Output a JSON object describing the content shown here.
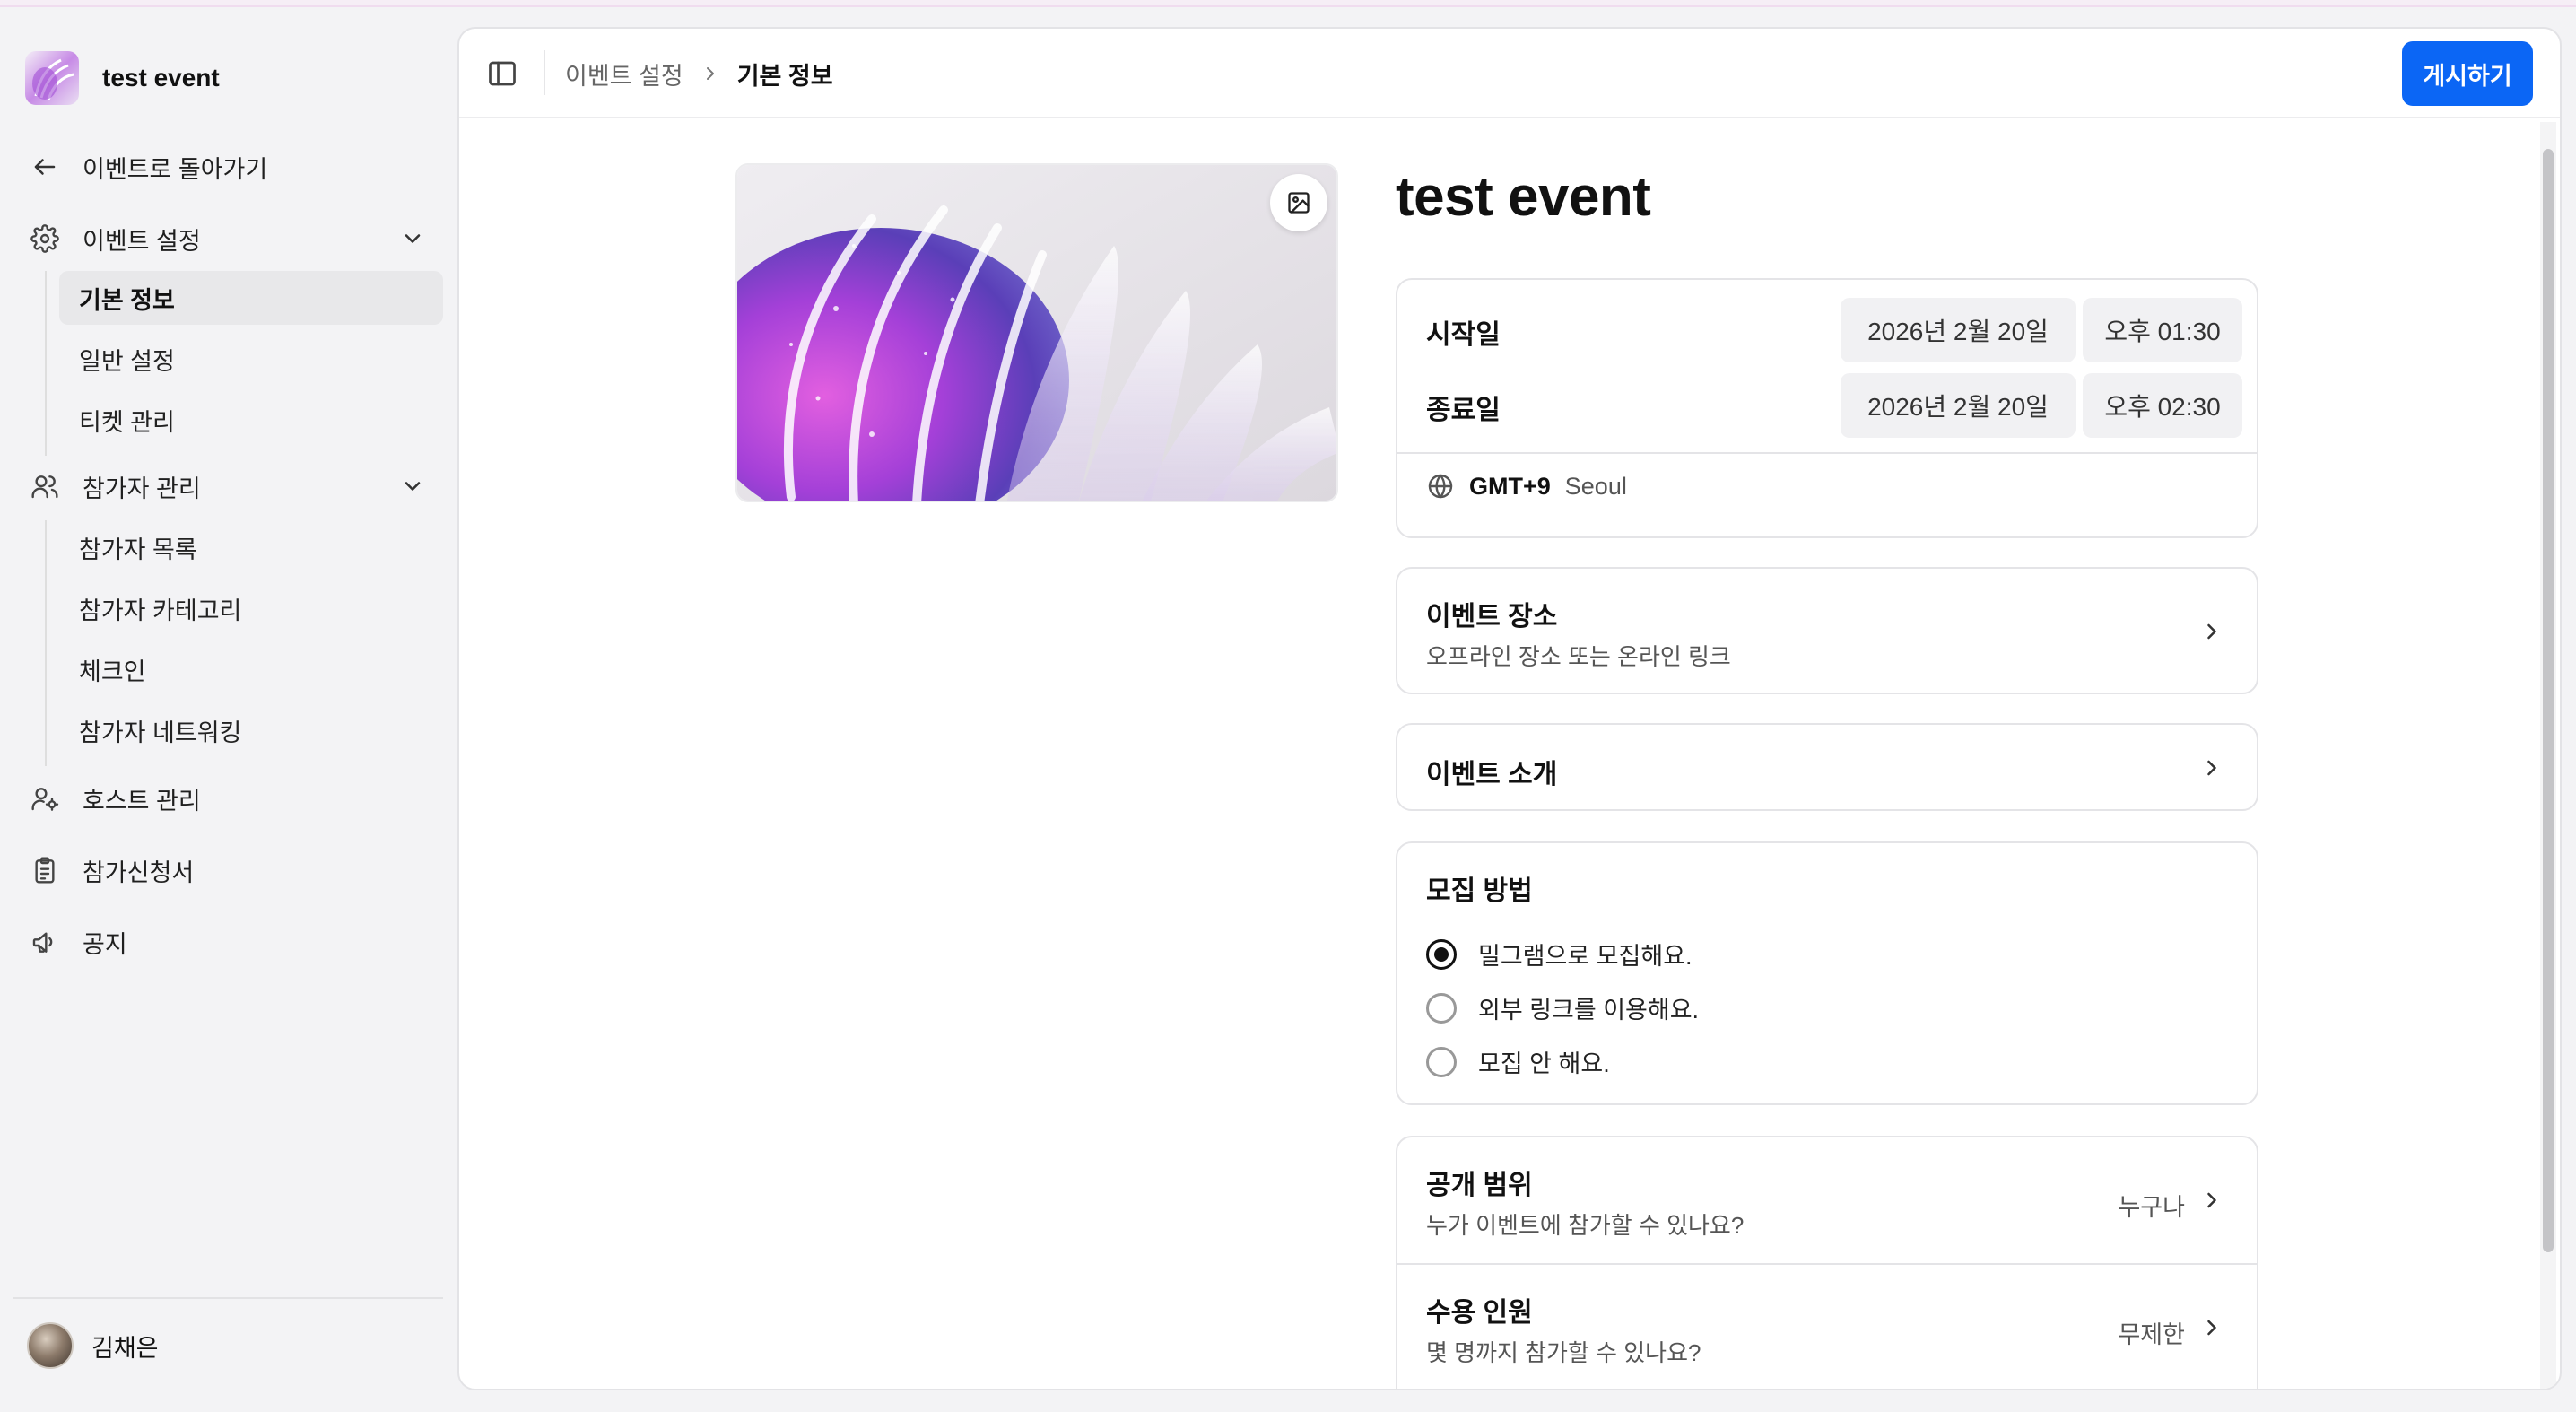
{
  "sidebar": {
    "event_name": "test event",
    "back_label": "이벤트로 돌아가기",
    "groups": [
      {
        "label": "이벤트 설정",
        "items": [
          "기본 정보",
          "일반 설정",
          "티켓 관리"
        ]
      },
      {
        "label": "참가자 관리",
        "items": [
          "참가자 목록",
          "참가자 카테고리",
          "체크인",
          "참가자 네트워킹"
        ]
      }
    ],
    "host_label": "호스트 관리",
    "application_label": "참가신청서",
    "notice_label": "공지",
    "user_name": "김채은"
  },
  "header": {
    "breadcrumb_parent": "이벤트 설정",
    "breadcrumb_current": "기본 정보",
    "publish_label": "게시하기"
  },
  "event": {
    "title": "test event",
    "start_label": "시작일",
    "start_date": "2026년 2월 20일",
    "start_time": "오후 01:30",
    "end_label": "종료일",
    "end_date": "2026년 2월 20일",
    "end_time": "오후 02:30",
    "tz_offset": "GMT+9",
    "tz_city": "Seoul"
  },
  "location": {
    "title": "이벤트 장소",
    "subtitle": "오프라인 장소 또는 온라인 링크"
  },
  "intro": {
    "title": "이벤트 소개"
  },
  "recruit": {
    "title": "모집 방법",
    "options": [
      "밀그램으로 모집해요.",
      "외부 링크를 이용해요.",
      "모집 안 해요."
    ],
    "selected_index": 0
  },
  "visibility": {
    "title": "공개 범위",
    "subtitle": "누가 이벤트에 참가할 수 있나요?",
    "value": "누구나"
  },
  "capacity": {
    "title": "수용 인원",
    "subtitle": "몇 명까지 참가할 수 있나요?",
    "value": "무제한"
  },
  "colors": {
    "accent": "#0b66f5"
  }
}
